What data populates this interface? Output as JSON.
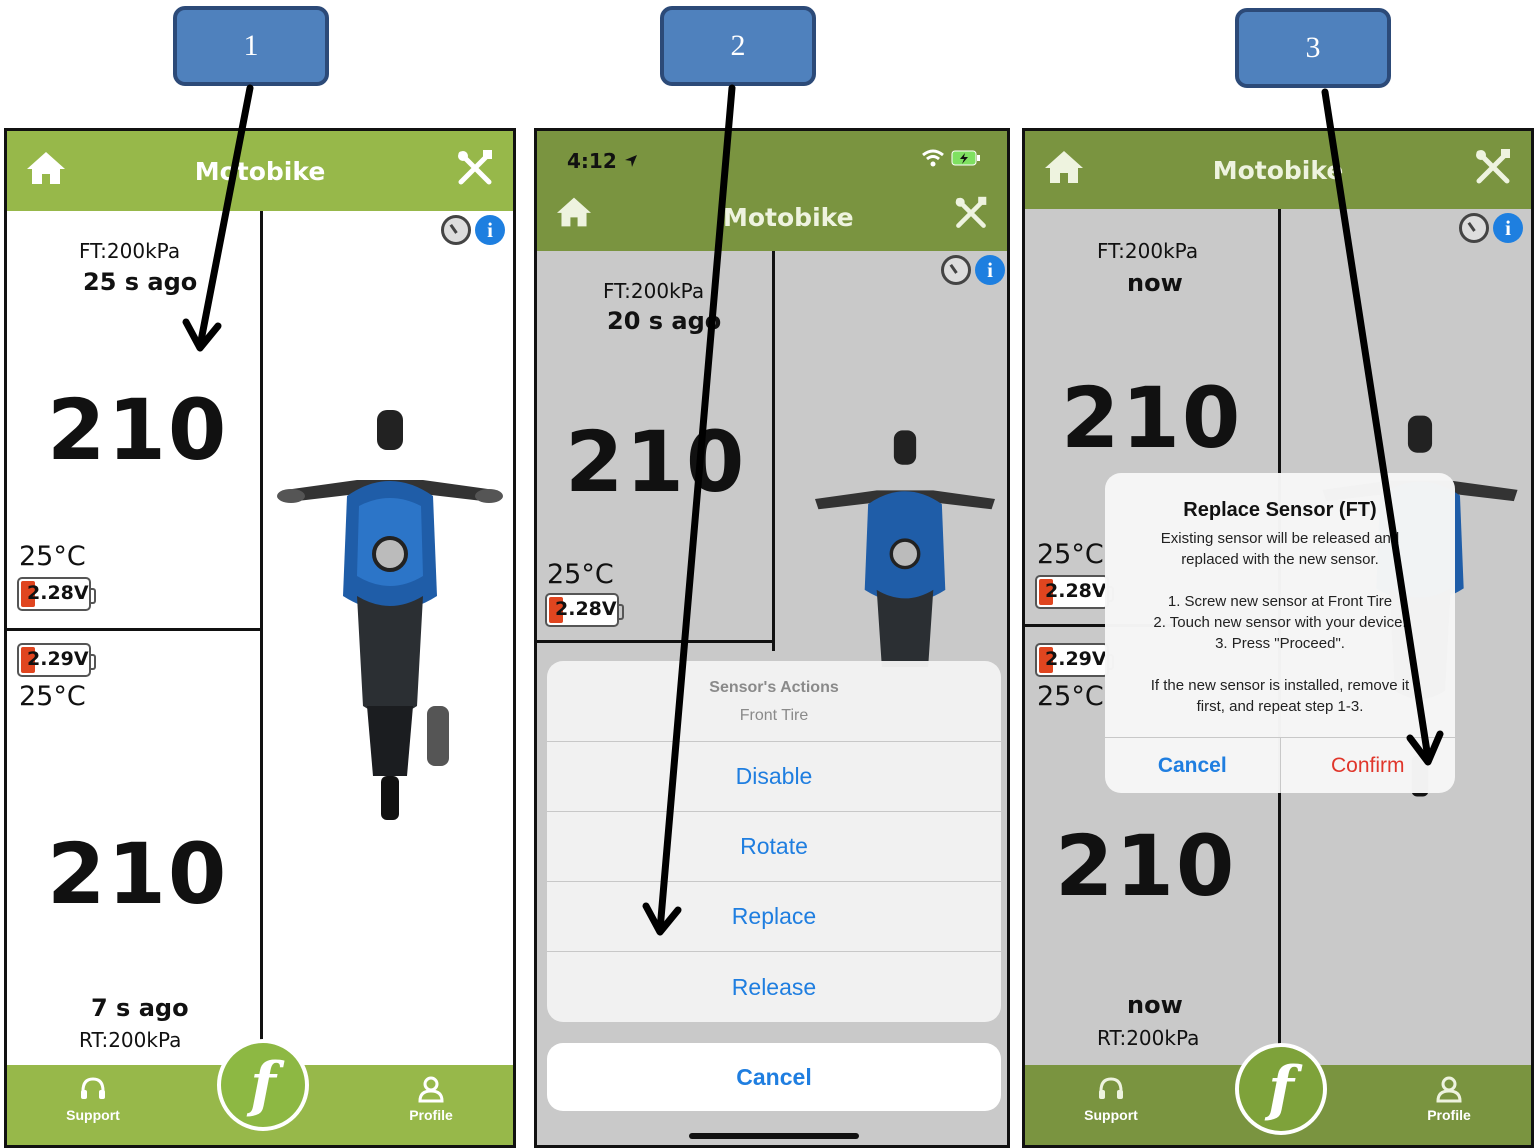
{
  "steps": [
    "1",
    "2",
    "3"
  ],
  "app_title": "Motobike",
  "status_time": "4:12",
  "readings": {
    "front_label": "FT:200kPa",
    "rear_label": "RT:200kPa",
    "pressure_value": "210",
    "temperature": "25°C",
    "front_voltage": "2.28V",
    "rear_voltage": "2.29V"
  },
  "screen1": {
    "front_ago": "25 s ago",
    "rear_ago": "7 s ago"
  },
  "screen2": {
    "front_ago": "20 s ago",
    "sheet_title": "Sensor's Actions",
    "sheet_subtitle": "Front Tire",
    "actions": [
      "Disable",
      "Rotate",
      "Replace",
      "Release"
    ],
    "cancel": "Cancel"
  },
  "screen3": {
    "front_ago": "now",
    "rear_ago": "now",
    "alert_title": "Replace Sensor (FT)",
    "alert_body": "Existing sensor will be released and\nreplaced with the new sensor.\n\n1. Screw new sensor at Front Tire\n2. Touch new sensor with your device.\n3. Press \"Proceed\".\n\nIf the new sensor is installed, remove it\nfirst, and repeat step 1-3.",
    "cancel": "Cancel",
    "confirm": "Confirm"
  },
  "footer": {
    "support": "Support",
    "profile": "Profile",
    "logo_letter": "f"
  },
  "colors": {
    "header_green": "#97b84a",
    "ios_blue": "#1f7ee0",
    "confirm_red": "#e0362b",
    "step_blue": "#4f81bd",
    "battery_red": "#e0451f"
  },
  "icons": [
    "home-icon",
    "tools-icon",
    "gauge-icon",
    "info-icon",
    "support-headset-icon",
    "profile-person-icon",
    "location-arrow-icon",
    "wifi-icon",
    "battery-charging-icon"
  ]
}
